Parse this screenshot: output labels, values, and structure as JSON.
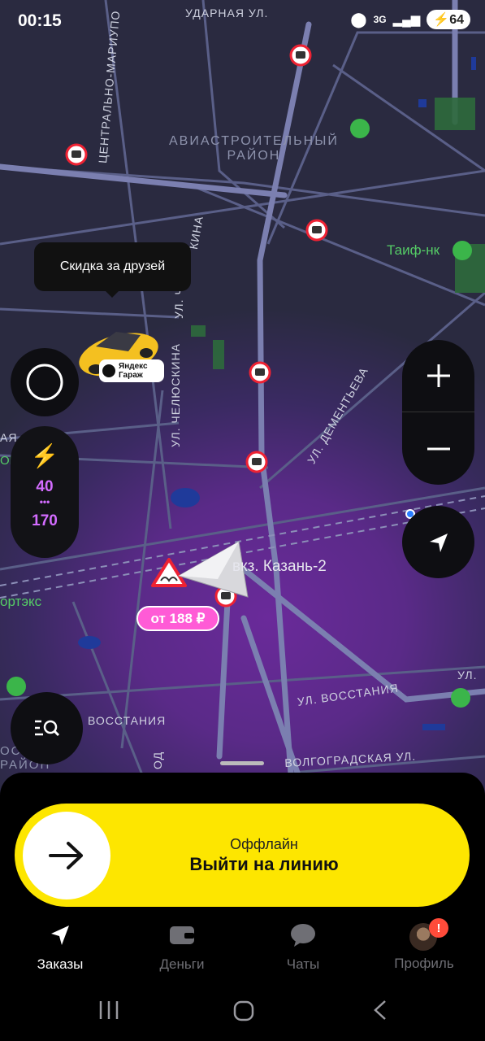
{
  "status": {
    "time": "00:15",
    "network": "3G",
    "battery": "64"
  },
  "map": {
    "street_udarnaya": "УДАРНАЯ УЛ.",
    "street_centr_mariupol": "ЦЕНТРАЛЬНО-МАРИУПО",
    "district_line1": "АВИАСТРОИТЕЛЬНЫЙ",
    "district_line2": "РАЙОН",
    "poi_taif": "Таиф-нк",
    "street_chelyuskina": "УЛ. ЧЕЛЮСКИНА",
    "street_chelyuskina_top": "УЛ. Ч",
    "street_chelyuskina_top2": "КИНА",
    "street_dementyeva": "УЛ. ДЕМЕНТЬЕВА",
    "station": "вкз. Казань-2",
    "edge_left_1": "АЯ",
    "edge_left_2": "ОРТ",
    "edge_left_3": "ортэкс",
    "street_vosstaniya_right": "УЛ. ВОССТАНИЯ",
    "street_vosstaniya_left": "ВОССТАНИЯ",
    "street_vosst_edge": "УЛ.",
    "street_volgogradskaya": "ВОЛГОГРАДСКАЯ УЛ.",
    "edge_left_4": "ОСОСКИЙ",
    "edge_left_5": "РАЙОН",
    "edge_od": "ОД"
  },
  "tooltip": "Скидка за друзей",
  "car_badge": {
    "line1": "Яндекс",
    "line2": "Гараж"
  },
  "speed": {
    "current": "40",
    "dots": "•••",
    "max": "170"
  },
  "price": "от 188 ₽",
  "cta": {
    "subtitle": "Оффлайн",
    "title": "Выйти на линию"
  },
  "tabs": [
    {
      "label": "Заказы",
      "icon": "navigation-arrow-icon",
      "active": true
    },
    {
      "label": "Деньги",
      "icon": "wallet-icon",
      "active": false
    },
    {
      "label": "Чаты",
      "icon": "chat-bubble-icon",
      "active": false
    },
    {
      "label": "Профиль",
      "icon": "avatar-icon",
      "active": false,
      "badge": "!"
    }
  ],
  "colors": {
    "accent_yellow": "#fde600",
    "price_pink": "#ff5bd6",
    "speed_purple": "#d36cff",
    "badge_red": "#ff4b3a"
  }
}
